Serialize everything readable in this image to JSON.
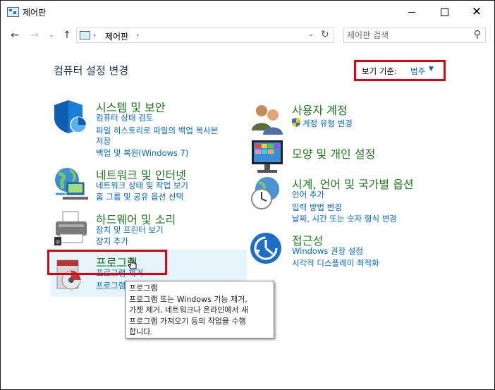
{
  "window": {
    "title": "제어판"
  },
  "nav": {
    "breadcrumb": "제어판",
    "search_placeholder": "제어판 검색"
  },
  "main": {
    "heading": "컴퓨터 설정 변경",
    "view_by_label": "보기 기준:",
    "view_by_value": "범주"
  },
  "categories": [
    {
      "title": "시스템 및 보안",
      "links": [
        "컴퓨터 상태 검토",
        "파일 히스토리로 파일의 백업 복사본",
        "저장",
        "백업 및 복원(Windows 7)"
      ],
      "icon": "shield-icon"
    },
    {
      "title": "네트워크 및 인터넷",
      "links": [
        "네트워크 상태 및 작업 보기",
        "홈 그룹 및 공유 옵션 선택"
      ],
      "icon": "network-globe-icon"
    },
    {
      "title": "하드웨어 및 소리",
      "links": [
        "장치 및 프린터 보기",
        "장치 추가"
      ],
      "icon": "printer-icon"
    },
    {
      "title": "프로그램",
      "links": [
        "프로그램 제거",
        "프로그램"
      ],
      "icon": "programs-disc-icon"
    },
    {
      "title": "사용자 계정",
      "links": [
        "계정 유형 변경"
      ],
      "icon": "users-icon"
    },
    {
      "title": "모양 및 개인 설정",
      "links": [],
      "icon": "monitor-icon"
    },
    {
      "title": "시계, 언어 및 국가별 옵션",
      "links": [
        "언어 추가",
        "입력 방법 변경",
        "날짜, 시간 또는 숫자 형식 변경"
      ],
      "icon": "clock-globe-icon"
    },
    {
      "title": "접근성",
      "links": [
        "Windows 권장 설정",
        "시각적 디스플레이 최적화"
      ],
      "icon": "accessibility-icon"
    }
  ],
  "tooltip": {
    "lines": [
      "프로그램",
      "프로그램 또는 Windows 기능 제거,",
      "가젯 제거, 네트워크나 온라인에서 새",
      "프로그램 가져오기 등의 작업을 수행",
      "합니다."
    ]
  },
  "colors": {
    "link": "#0066cc",
    "title": "#1e7a1e",
    "highlight": "#e3000f"
  }
}
